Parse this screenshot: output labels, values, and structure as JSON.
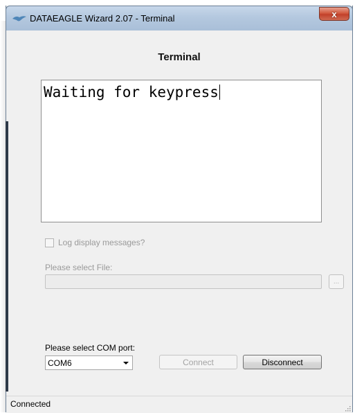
{
  "window": {
    "title": "DATAEAGLE Wizard 2.07 - Terminal",
    "close_glyph": "x"
  },
  "page": {
    "title": "Terminal"
  },
  "terminal": {
    "text": "Waiting for keypress"
  },
  "log": {
    "checkbox_label": "Log display messages?",
    "checked": false
  },
  "file": {
    "label": "Please select File:",
    "value": "",
    "browse_label": "..."
  },
  "com": {
    "label": "Please select COM port:",
    "selected": "COM6"
  },
  "buttons": {
    "connect": "Connect",
    "disconnect": "Disconnect"
  },
  "status": {
    "text": "Connected"
  },
  "colors": {
    "titlebar": "#b4c8df",
    "close_button": "#c2402a",
    "window_bg": "#f0f0f0",
    "disabled_text": "#9a9a9a"
  }
}
